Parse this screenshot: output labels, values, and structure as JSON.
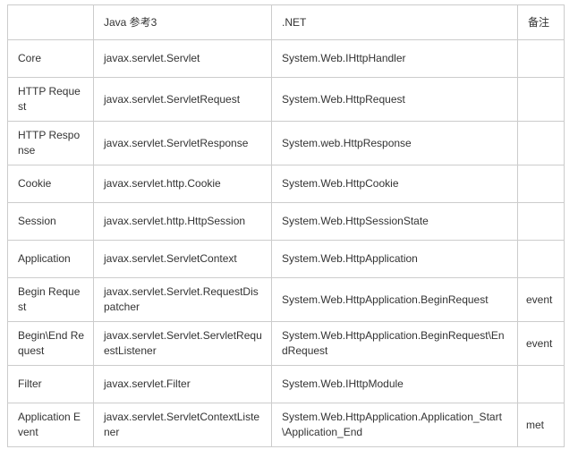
{
  "table": {
    "name": "java-servlet-dotnet-comparison",
    "columns": [
      {
        "key": "topic",
        "label": ""
      },
      {
        "key": "java",
        "label": "Java 参考3"
      },
      {
        "key": "net",
        "label": ".NET"
      },
      {
        "key": "remark",
        "label": "备注"
      }
    ],
    "rows": [
      {
        "topic": "Core",
        "java": "javax.servlet.Servlet",
        "net": "System.Web.IHttpHandler",
        "remark": ""
      },
      {
        "topic": "HTTP Request",
        "java": "javax.servlet.ServletRequest",
        "net": "System.Web.HttpRequest",
        "remark": ""
      },
      {
        "topic": "HTTP Response",
        "java": "javax.servlet.ServletResponse",
        "net": "System.web.HttpResponse",
        "remark": ""
      },
      {
        "topic": "Cookie",
        "java": "javax.servlet.http.Cookie",
        "net": "System.Web.HttpCookie",
        "remark": ""
      },
      {
        "topic": "Session",
        "java": "javax.servlet.http.HttpSession",
        "net": "System.Web.HttpSessionState",
        "remark": ""
      },
      {
        "topic": "Application",
        "java": "javax.servlet.ServletContext",
        "net": "System.Web.HttpApplication",
        "remark": ""
      },
      {
        "topic": "Begin Request",
        "java": "javax.servlet.Servlet.RequestDispatcher",
        "net": "System.Web.HttpApplication.BeginRequest",
        "remark": "event"
      },
      {
        "topic": "Begin\\End Request",
        "java": "javax.servlet.Servlet.ServletRequestListener",
        "net": "System.Web.HttpApplication.BeginRequest\\EndRequest",
        "remark": "event"
      },
      {
        "topic": "Filter",
        "java": "javax.servlet.Filter",
        "net": "System.Web.IHttpModule",
        "remark": ""
      },
      {
        "topic": "Application Event",
        "java": "javax.servlet.ServletContextListener",
        "net": "System.Web.HttpApplication.Application_Start\\Application_End",
        "remark": "met"
      }
    ]
  },
  "style": {
    "border_color": "#cccccc",
    "text_color": "#333333",
    "background": "#ffffff"
  }
}
